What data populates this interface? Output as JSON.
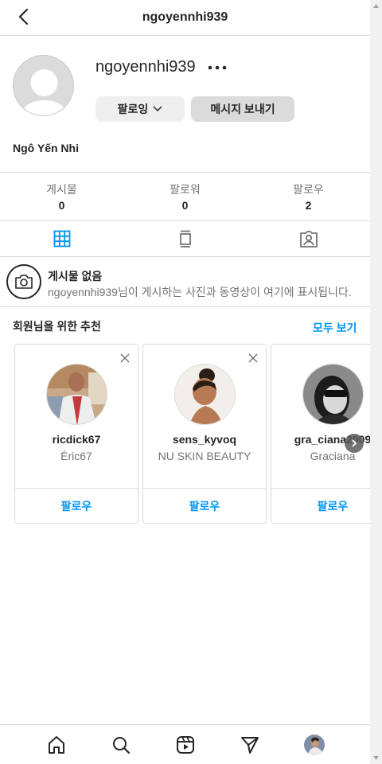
{
  "header": {
    "title": "ngoyennhi939"
  },
  "profile": {
    "username": "ngoyennhi939",
    "follow_label": "팔로잉",
    "message_label": "메시지 보내기",
    "full_name": "Ngô Yến Nhi"
  },
  "stats": [
    {
      "label": "게시물",
      "value": "0"
    },
    {
      "label": "팔로워",
      "value": "0"
    },
    {
      "label": "팔로우",
      "value": "2"
    }
  ],
  "tabs": [
    "posts-grid",
    "reels",
    "tagged"
  ],
  "empty": {
    "title": "게시물 없음",
    "subtitle": "ngoyennhi939님이 게시하는 사진과 동영상이 여기에 표시됩니다."
  },
  "suggestions": {
    "title": "회원님을 위한 추천",
    "see_all": "모두 보기",
    "cards": [
      {
        "username": "ricdick67",
        "subtitle": "Éric67",
        "button": "팔로우"
      },
      {
        "username": "sens_kyvoq",
        "subtitle": "NU SKIN BEAUTY",
        "button": "팔로우"
      },
      {
        "username": "gra_ciana2009",
        "subtitle": "Graciana",
        "button": "팔로우"
      }
    ]
  },
  "bottom_nav": [
    "home-icon",
    "search-icon",
    "reels-icon",
    "direct-icon",
    "profile-avatar"
  ],
  "colors": {
    "accent": "#0095f6",
    "border": "#dbdbdb",
    "text": "#262626",
    "muted": "#737373"
  }
}
